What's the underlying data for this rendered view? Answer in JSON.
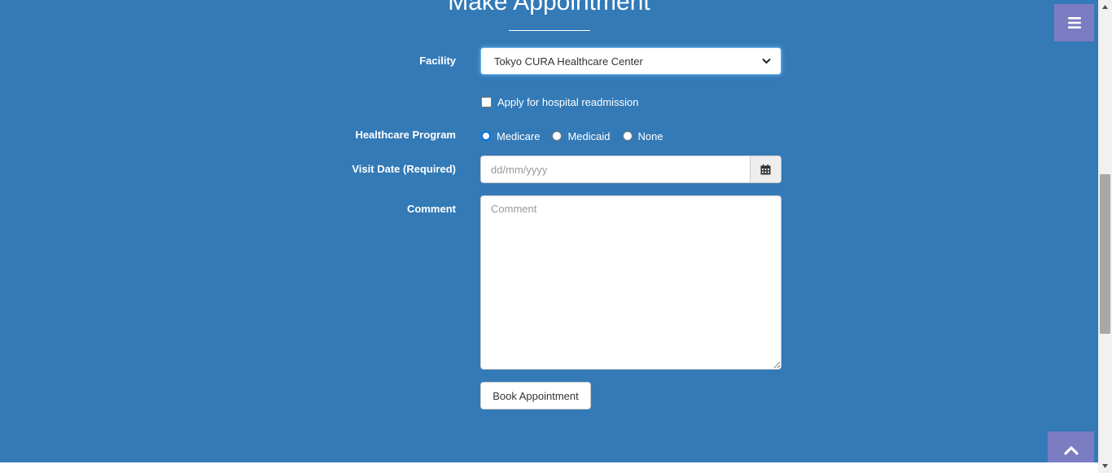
{
  "page": {
    "title": "Make Appointment"
  },
  "form": {
    "facility": {
      "label": "Facility",
      "selected": "Tokyo CURA Healthcare Center"
    },
    "readmission": {
      "label": "Apply for hospital readmission",
      "checked": false
    },
    "program": {
      "label": "Healthcare Program",
      "options": [
        "Medicare",
        "Medicaid",
        "None"
      ],
      "selected": "Medicare"
    },
    "visit_date": {
      "label": "Visit Date (Required)",
      "placeholder": "dd/mm/yyyy"
    },
    "comment": {
      "label": "Comment",
      "placeholder": "Comment"
    },
    "submit_label": "Book Appointment"
  },
  "icons": {
    "menu": "menu-icon",
    "scroll_top": "chevron-up-icon",
    "calendar": "calendar-icon",
    "select_arrow": "chevron-down-icon"
  },
  "colors": {
    "background": "#337ab7",
    "accent_button": "#7c7cc2",
    "radio_selected": "#0a74e6"
  }
}
